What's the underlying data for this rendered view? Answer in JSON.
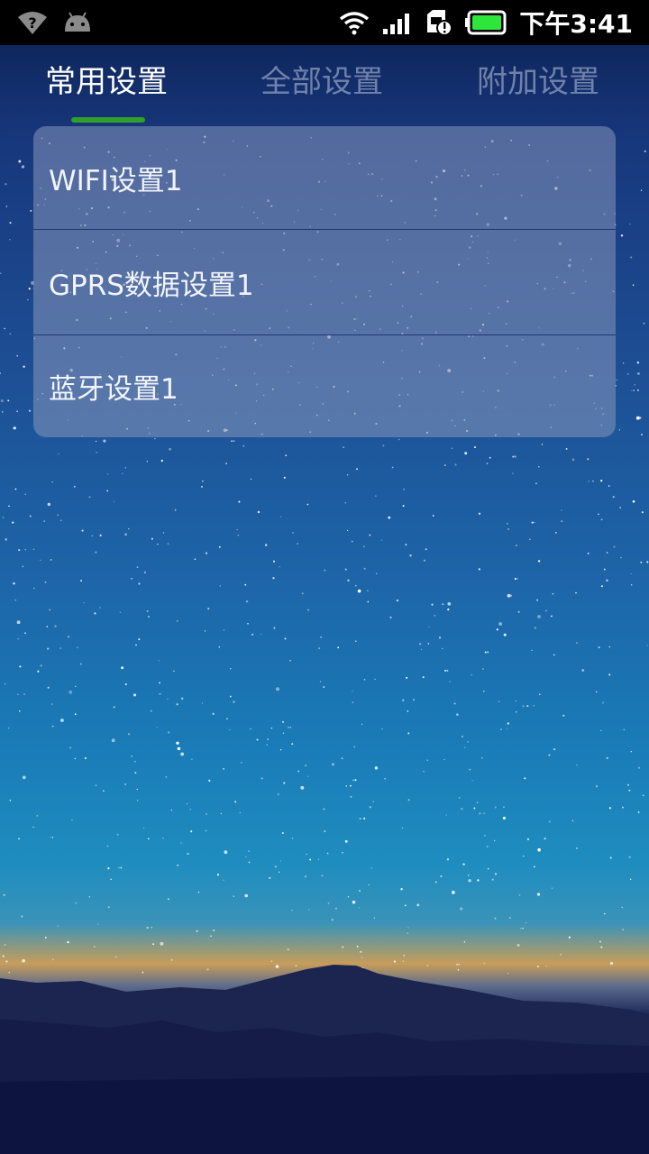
{
  "status_bar": {
    "left_icons": [
      "wifi-unknown-icon",
      "android-icon"
    ],
    "right_icons": [
      "wifi-icon",
      "signal-icon",
      "sim-alert-icon",
      "battery-icon"
    ],
    "time": "下午3:41",
    "battery_color": "#2ee63a"
  },
  "tabs": [
    {
      "label": "常用设置",
      "active": true
    },
    {
      "label": "全部设置",
      "active": false
    },
    {
      "label": "附加设置",
      "active": false
    }
  ],
  "indicator_color": "#2fa02a",
  "settings": [
    {
      "label": "WIFI设置1"
    },
    {
      "label": "GPRS数据设置1"
    },
    {
      "label": "蓝牙设置1"
    }
  ]
}
